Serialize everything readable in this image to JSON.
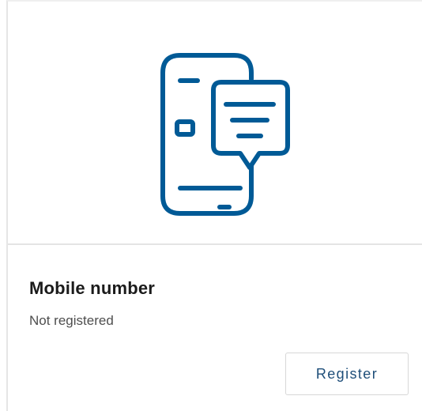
{
  "card": {
    "icon": "mobile-message-icon",
    "title": "Mobile number",
    "status": "Not registered",
    "register_label": "Register"
  },
  "colors": {
    "icon": "#005a96",
    "button_text": "#1e4e79",
    "title": "#1b1b1b",
    "status": "#4e4e4e"
  }
}
